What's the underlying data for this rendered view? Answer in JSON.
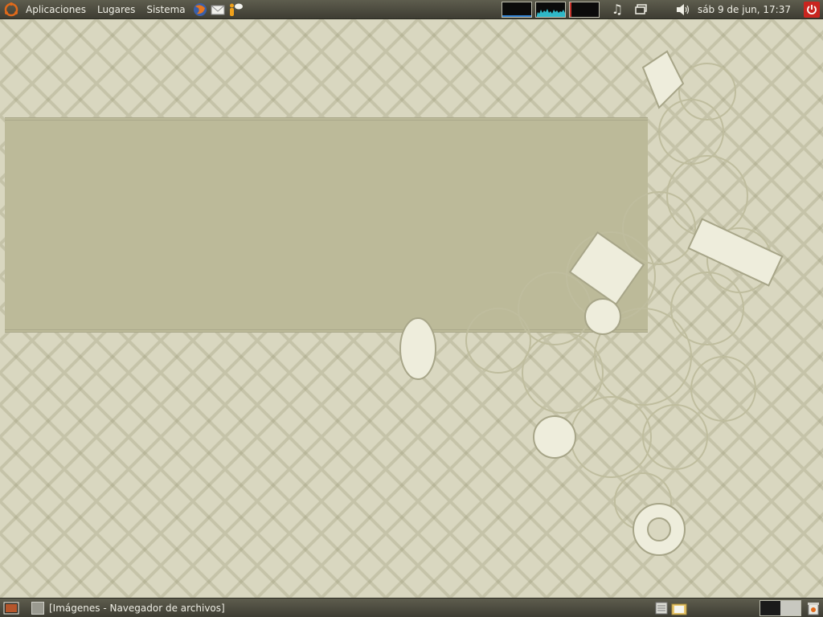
{
  "top_panel": {
    "menus": [
      "Aplicaciones",
      "Lugares",
      "Sistema"
    ],
    "launchers": [
      "firefox-icon",
      "mail-icon",
      "messenger-icon"
    ],
    "system_monitors": [
      "cpu-monitor",
      "network-monitor",
      "memory-monitor"
    ],
    "tray": [
      "music-icon",
      "display-icon",
      "volume-icon"
    ],
    "clock": "sáb  9 de jun, 17:37",
    "power_icon": "power-icon"
  },
  "bottom_panel": {
    "show_desktop_icon": "show-desktop-icon",
    "window_task": "[Imágenes - Navegador de archivos]",
    "tray": [
      "note-icon",
      "folder-icon"
    ],
    "trash_icon": "trash-icon"
  },
  "colors": {
    "panel": "#4e4d40",
    "desktop": "#d9d7c0",
    "banner": "#bcba99",
    "accent": "#e06a1b"
  }
}
